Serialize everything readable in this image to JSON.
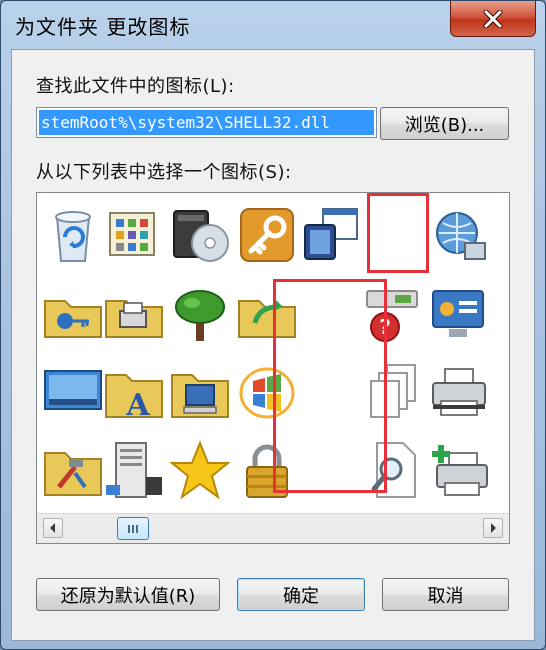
{
  "window": {
    "title": "为文件夹 更改图标"
  },
  "labels": {
    "find_icons": "查找此文件中的图标(L):",
    "select_icon": "从以下列表中选择一个图标(S):"
  },
  "path_field": {
    "value": "stemRoot%\\system32\\SHELL32.dll"
  },
  "buttons": {
    "browse": "浏览(B)...",
    "restore_default": "还原为默认值(R)",
    "ok": "确定",
    "cancel": "取消"
  },
  "icons": [
    "recycle-bin-icon",
    "control-panel-icon",
    "drive-disc-icon",
    "key-icon",
    "program-window-icon",
    "empty-slot",
    "network-globe-icon",
    "printer-partial-icon",
    "shared-folder-icon",
    "printer-folder-icon",
    "tree-icon",
    "folder-arrow-icon",
    "empty-slot",
    "help-drive-icon",
    "control-panel-display-icon",
    "printer-partial-icon",
    "monitor-icon",
    "fonts-folder-icon",
    "computer-folder-icon",
    "windows-logo-icon",
    "empty-slot",
    "documents-icon",
    "printer-icon",
    "printer-partial-icon",
    "tools-folder-icon",
    "server-icon",
    "star-icon",
    "padlock-icon",
    "empty-slot",
    "search-document-icon",
    "add-printer-icon",
    "printer-partial-icon"
  ],
  "colors": {
    "selection": "#3399ff",
    "highlight_box": "#e8303a",
    "title_bar": "#b9d1ea",
    "close_button": "#c43a1e"
  }
}
